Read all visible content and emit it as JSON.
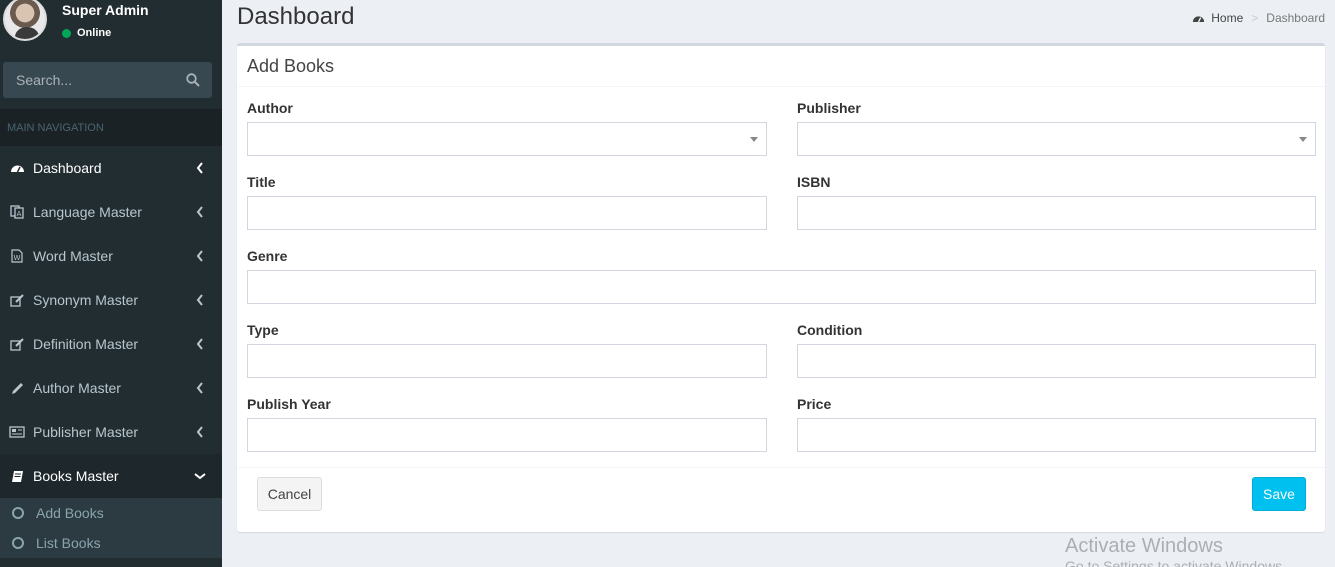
{
  "user": {
    "name": "Super Admin",
    "status": "Online"
  },
  "search": {
    "placeholder": "Search..."
  },
  "sidebar": {
    "header": "MAIN NAVIGATION",
    "items": [
      {
        "label": "Dashboard",
        "icon": "dashboard-icon"
      },
      {
        "label": "Language Master",
        "icon": "language-icon"
      },
      {
        "label": "Word Master",
        "icon": "word-file-icon"
      },
      {
        "label": "Synonym Master",
        "icon": "edit-icon"
      },
      {
        "label": "Definition Master",
        "icon": "edit-icon"
      },
      {
        "label": "Author Master",
        "icon": "pencil-icon"
      },
      {
        "label": "Publisher Master",
        "icon": "newspaper-icon"
      },
      {
        "label": "Books Master",
        "icon": "book-icon"
      }
    ],
    "subitems": [
      {
        "label": "Add Books"
      },
      {
        "label": "List Books"
      }
    ]
  },
  "page": {
    "title": "Dashboard",
    "breadcrumb": {
      "home": "Home",
      "current": "Dashboard"
    }
  },
  "form": {
    "title": "Add Books",
    "fields": {
      "author": {
        "label": "Author",
        "value": ""
      },
      "publisher": {
        "label": "Publisher",
        "value": ""
      },
      "title": {
        "label": "Title",
        "value": ""
      },
      "isbn": {
        "label": "ISBN",
        "value": ""
      },
      "genre": {
        "label": "Genre",
        "value": ""
      },
      "type": {
        "label": "Type",
        "value": ""
      },
      "condition": {
        "label": "Condition",
        "value": ""
      },
      "publish_year": {
        "label": "Publish Year",
        "value": ""
      },
      "price": {
        "label": "Price",
        "value": ""
      }
    },
    "cancel_label": "Cancel",
    "save_label": "Save"
  },
  "watermark": {
    "line1": "Activate Windows",
    "line2": "Go to Settings to activate Windows."
  },
  "colors": {
    "sidebar_bg": "#222d32",
    "accent": "#00c0ef",
    "online": "#00a65a"
  }
}
